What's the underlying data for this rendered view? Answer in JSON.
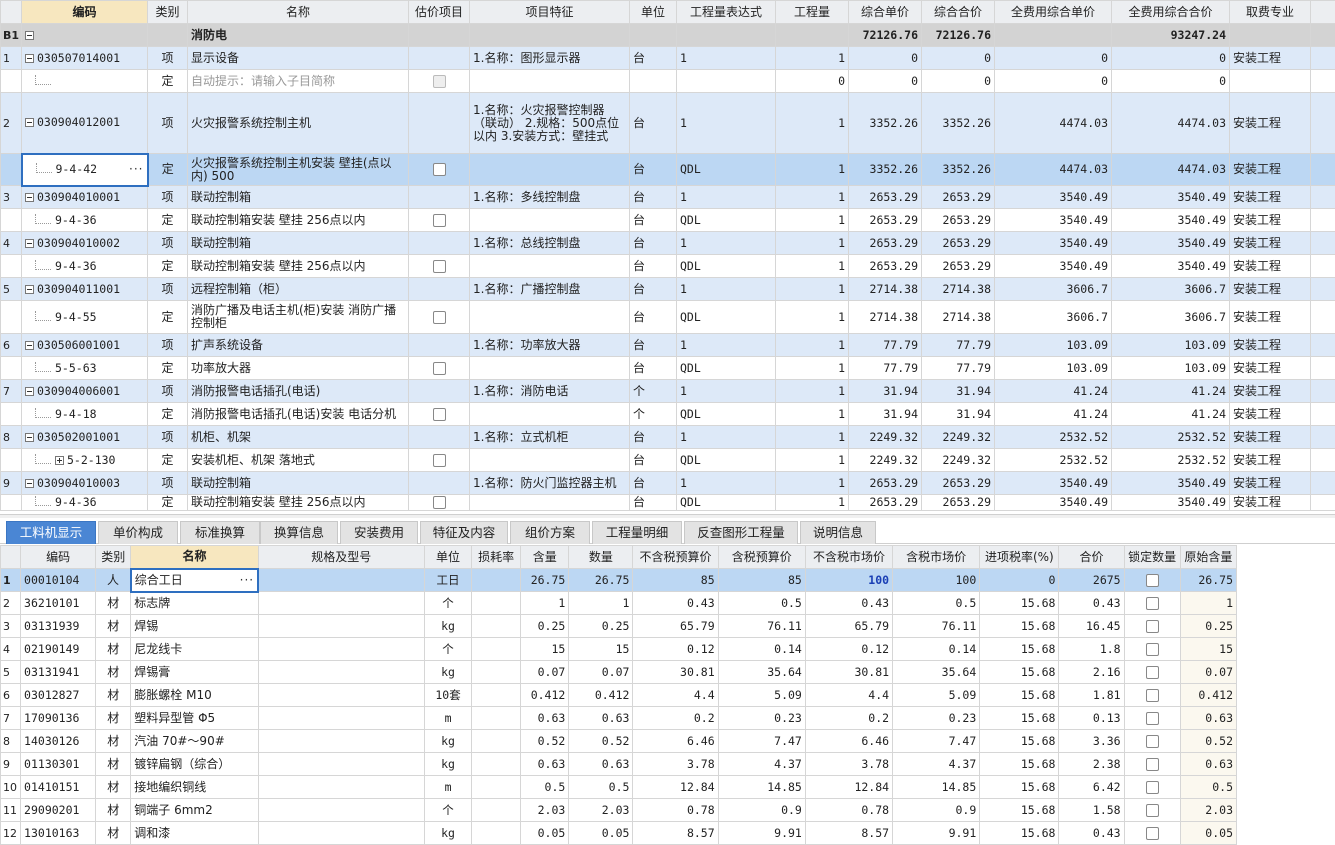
{
  "top_table": {
    "headers": [
      "",
      "编码",
      "类别",
      "名称",
      "估价项目",
      "项目特征",
      "单位",
      "工程量表达式",
      "工程量",
      "综合单价",
      "综合合价",
      "全费用综合单价",
      "全费用综合合价",
      "取费专业"
    ],
    "b1": {
      "label": "B1",
      "name": "消防电",
      "unit_total": "72126.76",
      "total": "72126.76",
      "full_total": "93247.24"
    },
    "rows": [
      {
        "no": "1",
        "type": "q",
        "code": "030507014001",
        "cat": "项",
        "name": "显示设备",
        "feature": "1.名称：图形显示器",
        "unit": "台",
        "expr": "1",
        "qty": "1",
        "up": "0",
        "tp": "0",
        "fup": "0",
        "ftp": "0",
        "spec": "安装工程"
      },
      {
        "no": "",
        "type": "d",
        "code": "",
        "cat": "定",
        "name": "自动提示：请输入子目简称",
        "feature": "",
        "unit": "",
        "expr": "",
        "qty": "0",
        "up": "0",
        "tp": "0",
        "fup": "0",
        "ftp": "0",
        "spec": "",
        "gray": true,
        "cbdis": true
      },
      {
        "no": "2",
        "type": "q",
        "code": "030904012001",
        "cat": "项",
        "name": "火灾报警系统控制主机",
        "feature": "1.名称：火灾报警控制器（联动）\n2.规格：500点位以内\n3.安装方式：壁挂式",
        "unit": "台",
        "expr": "1",
        "qty": "1",
        "up": "3352.26",
        "tp": "3352.26",
        "fup": "4474.03",
        "ftp": "4474.03",
        "spec": "安装工程",
        "h": 61
      },
      {
        "no": "",
        "type": "sel",
        "code": "9-4-42",
        "cat": "定",
        "name": "火灾报警系统控制主机安装 壁挂(点以内) 500",
        "feature": "",
        "unit": "台",
        "expr": "QDL",
        "qty": "1",
        "up": "3352.26",
        "tp": "3352.26",
        "fup": "4474.03",
        "ftp": "4474.03",
        "spec": "安装工程",
        "h": 32
      },
      {
        "no": "3",
        "type": "q",
        "code": "030904010001",
        "cat": "项",
        "name": "联动控制箱",
        "feature": "1.名称：多线控制盘",
        "unit": "台",
        "expr": "1",
        "qty": "1",
        "up": "2653.29",
        "tp": "2653.29",
        "fup": "3540.49",
        "ftp": "3540.49",
        "spec": "安装工程"
      },
      {
        "no": "",
        "type": "d",
        "code": "9-4-36",
        "cat": "定",
        "name": "联动控制箱安装 壁挂 256点以内",
        "feature": "",
        "unit": "台",
        "expr": "QDL",
        "qty": "1",
        "up": "2653.29",
        "tp": "2653.29",
        "fup": "3540.49",
        "ftp": "3540.49",
        "spec": "安装工程"
      },
      {
        "no": "4",
        "type": "q",
        "code": "030904010002",
        "cat": "项",
        "name": "联动控制箱",
        "feature": "1.名称：总线控制盘",
        "unit": "台",
        "expr": "1",
        "qty": "1",
        "up": "2653.29",
        "tp": "2653.29",
        "fup": "3540.49",
        "ftp": "3540.49",
        "spec": "安装工程"
      },
      {
        "no": "",
        "type": "d",
        "code": "9-4-36",
        "cat": "定",
        "name": "联动控制箱安装 壁挂 256点以内",
        "feature": "",
        "unit": "台",
        "expr": "QDL",
        "qty": "1",
        "up": "2653.29",
        "tp": "2653.29",
        "fup": "3540.49",
        "ftp": "3540.49",
        "spec": "安装工程"
      },
      {
        "no": "5",
        "type": "q",
        "code": "030904011001",
        "cat": "项",
        "name": "远程控制箱（柜）",
        "feature": "1.名称：广播控制盘",
        "unit": "台",
        "expr": "1",
        "qty": "1",
        "up": "2714.38",
        "tp": "2714.38",
        "fup": "3606.7",
        "ftp": "3606.7",
        "spec": "安装工程"
      },
      {
        "no": "",
        "type": "d",
        "code": "9-4-55",
        "cat": "定",
        "name": "消防广播及电话主机(柜)安装 消防广播控制柜",
        "feature": "",
        "unit": "台",
        "expr": "QDL",
        "qty": "1",
        "up": "2714.38",
        "tp": "2714.38",
        "fup": "3606.7",
        "ftp": "3606.7",
        "spec": "安装工程",
        "h": 33
      },
      {
        "no": "6",
        "type": "q",
        "code": "030506001001",
        "cat": "项",
        "name": "扩声系统设备",
        "feature": "1.名称：功率放大器",
        "unit": "台",
        "expr": "1",
        "qty": "1",
        "up": "77.79",
        "tp": "77.79",
        "fup": "103.09",
        "ftp": "103.09",
        "spec": "安装工程"
      },
      {
        "no": "",
        "type": "d",
        "code": "5-5-63",
        "cat": "定",
        "name": "功率放大器",
        "feature": "",
        "unit": "台",
        "expr": "QDL",
        "qty": "1",
        "up": "77.79",
        "tp": "77.79",
        "fup": "103.09",
        "ftp": "103.09",
        "spec": "安装工程"
      },
      {
        "no": "7",
        "type": "q",
        "code": "030904006001",
        "cat": "项",
        "name": "消防报警电话插孔(电话)",
        "feature": "1.名称：消防电话",
        "unit": "个",
        "expr": "1",
        "qty": "1",
        "up": "31.94",
        "tp": "31.94",
        "fup": "41.24",
        "ftp": "41.24",
        "spec": "安装工程"
      },
      {
        "no": "",
        "type": "d",
        "code": "9-4-18",
        "cat": "定",
        "name": "消防报警电话插孔(电话)安装 电话分机",
        "feature": "",
        "unit": "个",
        "expr": "QDL",
        "qty": "1",
        "up": "31.94",
        "tp": "31.94",
        "fup": "41.24",
        "ftp": "41.24",
        "spec": "安装工程"
      },
      {
        "no": "8",
        "type": "q",
        "code": "030502001001",
        "cat": "项",
        "name": "机柜、机架",
        "feature": "1.名称：立式机柜",
        "unit": "台",
        "expr": "1",
        "qty": "1",
        "up": "2249.32",
        "tp": "2249.32",
        "fup": "2532.52",
        "ftp": "2532.52",
        "spec": "安装工程"
      },
      {
        "no": "",
        "type": "d",
        "code": "5-2-130",
        "cat": "定",
        "name": "安装机柜、机架 落地式",
        "feature": "",
        "unit": "台",
        "expr": "QDL",
        "qty": "1",
        "up": "2249.32",
        "tp": "2249.32",
        "fup": "2532.52",
        "ftp": "2532.52",
        "spec": "安装工程",
        "plus": true
      },
      {
        "no": "9",
        "type": "q",
        "code": "030904010003",
        "cat": "项",
        "name": "联动控制箱",
        "feature": "1.名称：防火门监控器主机",
        "unit": "台",
        "expr": "1",
        "qty": "1",
        "up": "2653.29",
        "tp": "2653.29",
        "fup": "3540.49",
        "ftp": "3540.49",
        "spec": "安装工程"
      },
      {
        "no": "",
        "type": "d",
        "code": "9-4-36",
        "cat": "定",
        "name": "联动控制箱安装 壁挂 256点以内",
        "feature": "",
        "unit": "台",
        "expr": "QDL",
        "qty": "1",
        "up": "2653.29",
        "tp": "2653.29",
        "fup": "3540.49",
        "ftp": "3540.49",
        "spec": "安装工程",
        "h": 16
      }
    ]
  },
  "tabs": [
    "工料机显示",
    "单价构成",
    "标准换算",
    "换算信息",
    "安装费用",
    "特征及内容",
    "组价方案",
    "工程量明细",
    "反查图形工程量",
    "说明信息"
  ],
  "bottom_table": {
    "headers": [
      "",
      "编码",
      "类别",
      "名称",
      "规格及型号",
      "单位",
      "损耗率",
      "含量",
      "数量",
      "不含税预算价",
      "含税预算价",
      "不含税市场价",
      "含税市场价",
      "进项税率(%)",
      "合价",
      "锁定数量",
      "原始含量"
    ],
    "rows": [
      {
        "no": "1",
        "code": "00010104",
        "cat": "人",
        "name": "综合工日",
        "spec": "",
        "unit": "工日",
        "loss": "",
        "content": "26.75",
        "qty": "26.75",
        "p1": "85",
        "p2": "85",
        "p3": "100",
        "p4": "100",
        "tax": "0",
        "total": "2675",
        "orig": "26.75"
      },
      {
        "no": "2",
        "code": "36210101",
        "cat": "材",
        "name": "标志牌",
        "spec": "",
        "unit": "个",
        "loss": "",
        "content": "1",
        "qty": "1",
        "p1": "0.43",
        "p2": "0.5",
        "p3": "0.43",
        "p4": "0.5",
        "tax": "15.68",
        "total": "0.43",
        "orig": "1"
      },
      {
        "no": "3",
        "code": "03131939",
        "cat": "材",
        "name": "焊锡",
        "spec": "",
        "unit": "kg",
        "loss": "",
        "content": "0.25",
        "qty": "0.25",
        "p1": "65.79",
        "p2": "76.11",
        "p3": "65.79",
        "p4": "76.11",
        "tax": "15.68",
        "total": "16.45",
        "orig": "0.25"
      },
      {
        "no": "4",
        "code": "02190149",
        "cat": "材",
        "name": "尼龙线卡",
        "spec": "",
        "unit": "个",
        "loss": "",
        "content": "15",
        "qty": "15",
        "p1": "0.12",
        "p2": "0.14",
        "p3": "0.12",
        "p4": "0.14",
        "tax": "15.68",
        "total": "1.8",
        "orig": "15"
      },
      {
        "no": "5",
        "code": "03131941",
        "cat": "材",
        "name": "焊锡膏",
        "spec": "",
        "unit": "kg",
        "loss": "",
        "content": "0.07",
        "qty": "0.07",
        "p1": "30.81",
        "p2": "35.64",
        "p3": "30.81",
        "p4": "35.64",
        "tax": "15.68",
        "total": "2.16",
        "orig": "0.07"
      },
      {
        "no": "6",
        "code": "03012827",
        "cat": "材",
        "name": "膨胀螺栓 M10",
        "spec": "",
        "unit": "10套",
        "loss": "",
        "content": "0.412",
        "qty": "0.412",
        "p1": "4.4",
        "p2": "5.09",
        "p3": "4.4",
        "p4": "5.09",
        "tax": "15.68",
        "total": "1.81",
        "orig": "0.412"
      },
      {
        "no": "7",
        "code": "17090136",
        "cat": "材",
        "name": "塑料异型管 Φ5",
        "spec": "",
        "unit": "m",
        "loss": "",
        "content": "0.63",
        "qty": "0.63",
        "p1": "0.2",
        "p2": "0.23",
        "p3": "0.2",
        "p4": "0.23",
        "tax": "15.68",
        "total": "0.13",
        "orig": "0.63"
      },
      {
        "no": "8",
        "code": "14030126",
        "cat": "材",
        "name": "汽油 70#～90#",
        "spec": "",
        "unit": "kg",
        "loss": "",
        "content": "0.52",
        "qty": "0.52",
        "p1": "6.46",
        "p2": "7.47",
        "p3": "6.46",
        "p4": "7.47",
        "tax": "15.68",
        "total": "3.36",
        "orig": "0.52"
      },
      {
        "no": "9",
        "code": "01130301",
        "cat": "材",
        "name": "镀锌扁钢（综合）",
        "spec": "",
        "unit": "kg",
        "loss": "",
        "content": "0.63",
        "qty": "0.63",
        "p1": "3.78",
        "p2": "4.37",
        "p3": "3.78",
        "p4": "4.37",
        "tax": "15.68",
        "total": "2.38",
        "orig": "0.63"
      },
      {
        "no": "10",
        "code": "01410151",
        "cat": "材",
        "name": "接地编织铜线",
        "spec": "",
        "unit": "m",
        "loss": "",
        "content": "0.5",
        "qty": "0.5",
        "p1": "12.84",
        "p2": "14.85",
        "p3": "12.84",
        "p4": "14.85",
        "tax": "15.68",
        "total": "6.42",
        "orig": "0.5"
      },
      {
        "no": "11",
        "code": "29090201",
        "cat": "材",
        "name": "铜端子 6mm2",
        "spec": "",
        "unit": "个",
        "loss": "",
        "content": "2.03",
        "qty": "2.03",
        "p1": "0.78",
        "p2": "0.9",
        "p3": "0.78",
        "p4": "0.9",
        "tax": "15.68",
        "total": "1.58",
        "orig": "2.03"
      },
      {
        "no": "12",
        "code": "13010163",
        "cat": "材",
        "name": "调和漆",
        "spec": "",
        "unit": "kg",
        "loss": "",
        "content": "0.05",
        "qty": "0.05",
        "p1": "8.57",
        "p2": "9.91",
        "p3": "8.57",
        "p4": "9.91",
        "tax": "15.68",
        "total": "0.43",
        "orig": "0.05"
      }
    ]
  }
}
